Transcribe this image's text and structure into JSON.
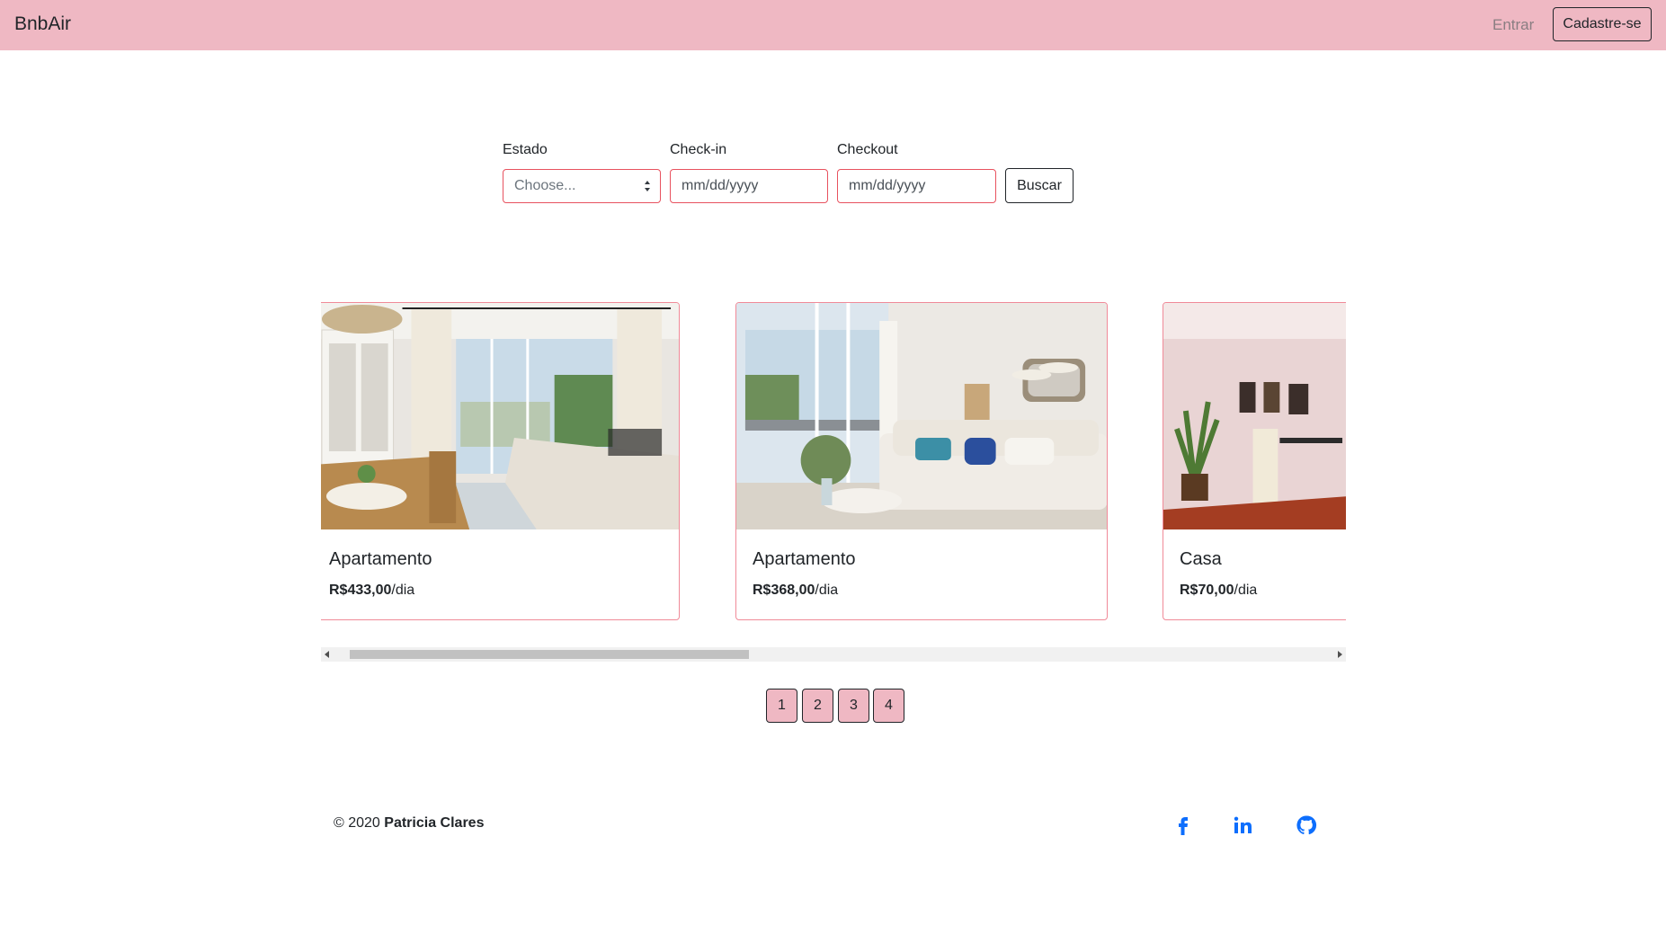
{
  "navbar": {
    "brand": "BnbAir",
    "login_label": "Entrar",
    "signup_label": "Cadastre-se"
  },
  "search": {
    "state_label": "Estado",
    "state_value": "Choose...",
    "checkin_label": "Check-in",
    "checkin_placeholder": "mm/dd/yyyy",
    "checkout_label": "Checkout",
    "checkout_placeholder": "mm/dd/yyyy",
    "submit_label": "Buscar"
  },
  "listings": [
    {
      "title": "Apartamento",
      "price": "R$433,00",
      "unit": "/dia"
    },
    {
      "title": "Apartamento",
      "price": "R$368,00",
      "unit": "/dia"
    },
    {
      "title": "Casa",
      "price": "R$70,00",
      "unit": "/dia"
    }
  ],
  "scroll": {
    "position": 0.0
  },
  "pagination": {
    "pages": [
      "1",
      "2",
      "3",
      "4"
    ]
  },
  "footer": {
    "copyright_prefix": "© 2020",
    "author": "Patricia Clares",
    "social_icons": [
      "facebook-icon",
      "linkedin-icon",
      "github-icon"
    ],
    "icon_color": "#0d6efd"
  },
  "colors": {
    "navbar_bg": "#efb8c3",
    "accent_border": "#e8525f",
    "card_border": "#f08a98"
  }
}
